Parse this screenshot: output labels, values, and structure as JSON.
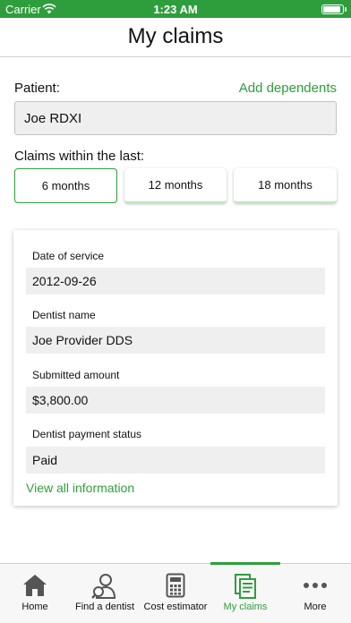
{
  "status_bar": {
    "carrier": "Carrier",
    "time": "1:23 AM"
  },
  "header": {
    "title": "My claims"
  },
  "patient": {
    "label": "Patient:",
    "add_link": "Add dependents",
    "value": "Joe RDXI"
  },
  "claims_filter": {
    "label": "Claims within the last:",
    "options": [
      "6 months",
      "12 months",
      "18 months"
    ],
    "selected": "6 months"
  },
  "claim": {
    "date_label": "Date of service",
    "date_value": "2012-09-26",
    "dentist_label": "Dentist name",
    "dentist_value": "Joe Provider DDS",
    "amount_label": "Submitted amount",
    "amount_value": "$3,800.00",
    "status_label": "Dentist payment status",
    "status_value": "Paid",
    "view_all": "View all information"
  },
  "tabs": [
    {
      "label": "Home",
      "icon": "home-icon"
    },
    {
      "label": "Find a dentist",
      "icon": "find-dentist-icon"
    },
    {
      "label": "Cost estimator",
      "icon": "calculator-icon"
    },
    {
      "label": "My claims",
      "icon": "claims-icon",
      "active": true
    },
    {
      "label": "More",
      "icon": "more-icon"
    }
  ],
  "colors": {
    "accent": "#2e9e3c",
    "field_bg": "#efefef",
    "icon_gray": "#555555"
  }
}
